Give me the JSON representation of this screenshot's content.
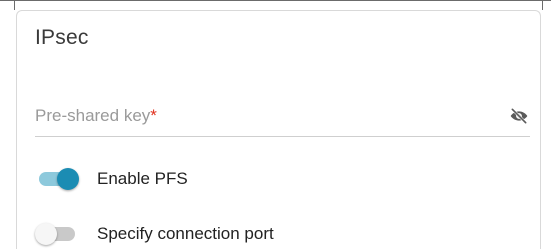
{
  "section": {
    "title": "IPsec"
  },
  "psk_field": {
    "label": "Pre-shared key",
    "required_marker": "*",
    "value": "",
    "visibility_icon": "eye-off-icon"
  },
  "toggles": [
    {
      "label": "Enable PFS",
      "checked": true
    },
    {
      "label": "Specify connection port",
      "checked": false
    }
  ],
  "colors": {
    "accent": "#1b8cb3",
    "accent_track": "#8dc9dc",
    "required": "#e0301e"
  }
}
